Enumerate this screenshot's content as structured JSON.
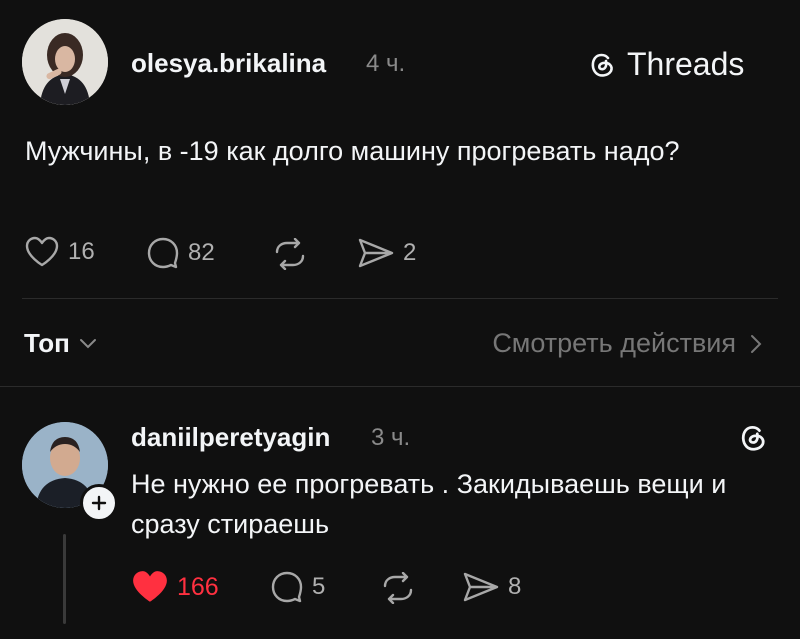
{
  "post": {
    "username": "olesya.brikalina",
    "time": "4 ч.",
    "brand_label": "Threads",
    "text": "Мужчины, в -19 как долго машину прогревать надо?",
    "likes": "16",
    "replies": "82",
    "shares": "2"
  },
  "filter": {
    "sort_label": "Топ",
    "activity_label": "Смотреть действия"
  },
  "reply": {
    "username": "daniilperetyagin",
    "time": "3 ч.",
    "text": "Не нужно ее прогревать . Закидываешь вещи и сразу стираешь",
    "likes": "166",
    "replies": "5",
    "shares": "8"
  },
  "colors": {
    "background": "#101010",
    "text": "#f3f5f7",
    "muted": "#8a8a8a",
    "liked": "#ff3040"
  }
}
